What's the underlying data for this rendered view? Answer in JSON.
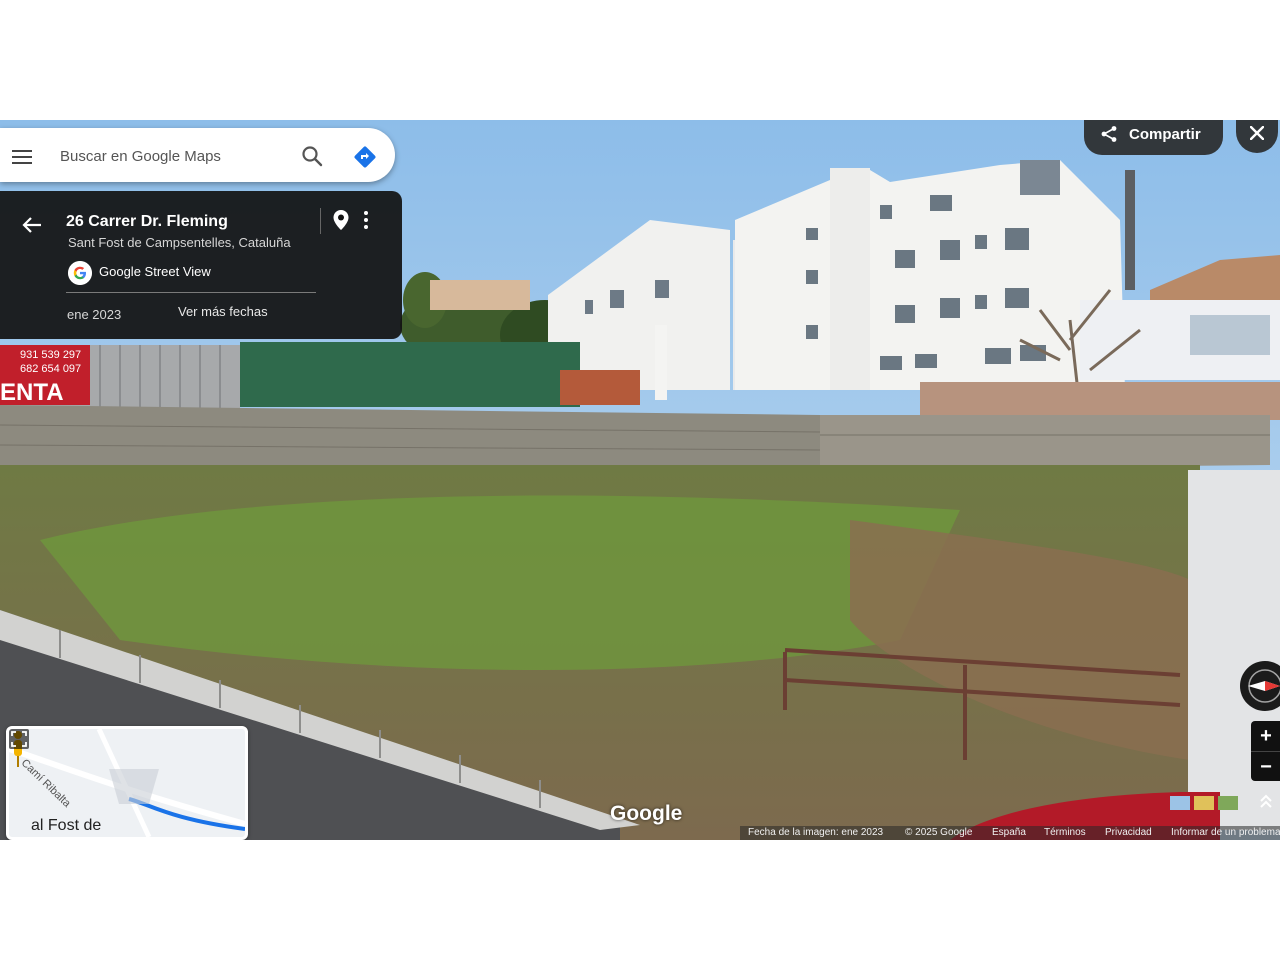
{
  "search": {
    "placeholder": "Buscar en Google Maps"
  },
  "place": {
    "title": "26 Carrer Dr. Fleming",
    "subtitle": "Sant Fost de Campsentelles, Cataluña",
    "provider": "Google Street View",
    "capture_date": "ene 2023",
    "more_dates": "Ver más fechas"
  },
  "toolbar": {
    "share_label": "Compartir"
  },
  "controls": {
    "zoom_in": "+",
    "zoom_out": "−"
  },
  "scene": {
    "sign_phone_1": "931 539 297",
    "sign_phone_2": "682 654 097",
    "sign_word": "ENTA"
  },
  "watermark": "Google",
  "footer": {
    "image_date": "Fecha de la imagen: ene 2023",
    "copyright": "© 2025 Google",
    "country": "España",
    "terms": "Términos",
    "privacy": "Privacidad",
    "report": "Informar de un problema"
  },
  "minimap": {
    "street": "Camí Ribalta",
    "town": "al Fost de"
  },
  "colors": {
    "accent_blue": "#1a73e8",
    "panel_dark": "#121212",
    "pegman_yellow": "#f4b400"
  }
}
